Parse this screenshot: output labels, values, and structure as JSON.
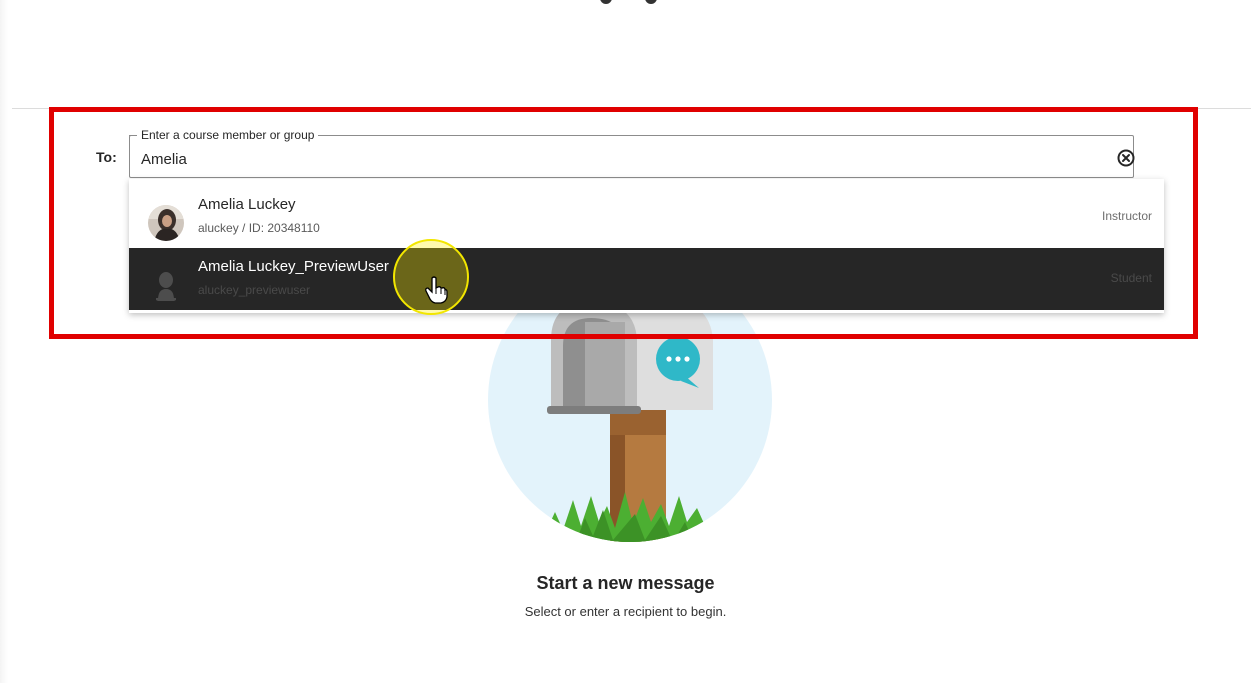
{
  "recipient": {
    "label": "To:",
    "field_legend": "Enter a course member or group",
    "value": "Amelia",
    "clear_icon": "clear-circle-x-icon"
  },
  "suggestions": [
    {
      "name": "Amelia Luckey",
      "detail": "aluckey / ID: 20348110",
      "role": "Instructor",
      "avatar": "profile-photo"
    },
    {
      "name": "Amelia Luckey_PreviewUser",
      "detail": "aluckey_previewuser",
      "role": "Student",
      "avatar": "default-user-silhouette",
      "hovered": true
    }
  ],
  "empty_state": {
    "title": "Start a new message",
    "subtitle": "Select or enter a recipient to begin.",
    "illustration": "mailbox-illustration"
  },
  "colors": {
    "highlight_border": "#e00000",
    "hover_row": "#262626",
    "cursor_halo": "#f2e600",
    "illustration_circle": "#e3f3fb",
    "speech_bubble": "#2fb8c8",
    "grass": "#4caf32"
  },
  "cursor": "hand-pointer-icon"
}
